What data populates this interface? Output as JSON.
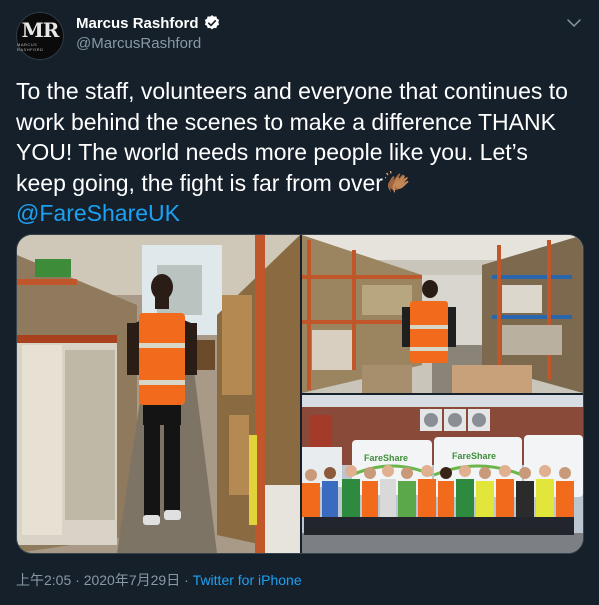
{
  "author": {
    "display_name": "Marcus Rashford",
    "handle": "@MarcusRashford",
    "avatar_monogram": "MR",
    "avatar_caption": "MARCUS RASHFORD",
    "verified": true
  },
  "tweet": {
    "text": "To the staff, volunteers and everyone that continues to work behind the scenes to make a difference THANK YOU! The world needs more people like you. Let’s keep going, the fight is far from over",
    "emoji": "clapping-hands-medium-dark-skin",
    "mention": "@FareShareUK"
  },
  "media": {
    "van_brand": "FareShare"
  },
  "footer": {
    "time": "上午2:05",
    "separator": " · ",
    "date": "2020年7月29日",
    "source": "Twitter for iPhone"
  },
  "colors": {
    "background": "#15202b",
    "secondary_text": "#8899a6",
    "link": "#1da1f2",
    "vest": "#f26a1b"
  }
}
